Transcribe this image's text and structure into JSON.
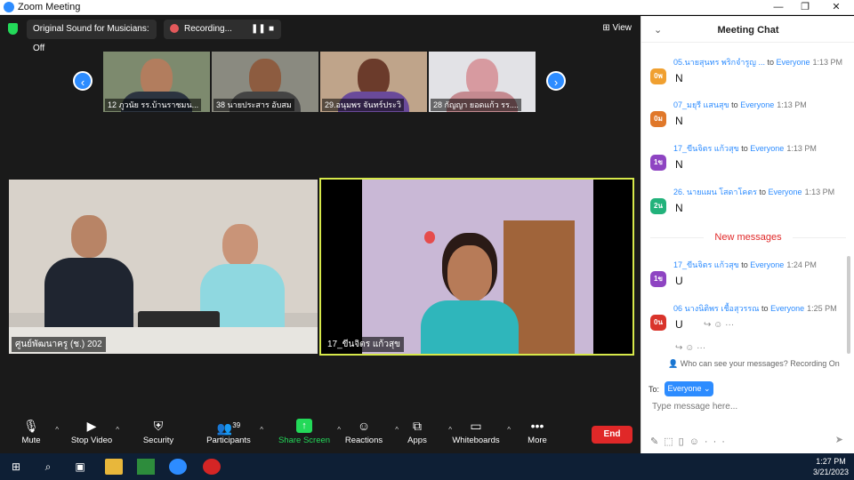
{
  "window": {
    "title": "Zoom Meeting"
  },
  "topbar": {
    "sound_label": "Original Sound for Musicians: Off",
    "recording_label": "Recording...",
    "view_label": "View"
  },
  "thumbnails": [
    {
      "name": "12 ภูวนัย  รร.บ้านราชมน..."
    },
    {
      "name": "38 นายประสาร อับสม"
    },
    {
      "name": "29.อนุมพร จันทร์ประวิ"
    },
    {
      "name": "28 กัญญา  ยอดแก้ว รร...."
    }
  ],
  "main_tiles": [
    {
      "name": "ศูนย์พัฒนาครู (ช.) 202"
    },
    {
      "name": "17_ขีนจิตร แก้วสุข"
    }
  ],
  "toolbar": {
    "mute": "Mute",
    "stop_video": "Stop Video",
    "security": "Security",
    "participants": "Participants",
    "participants_count": "39",
    "share_screen": "Share Screen",
    "reactions": "Reactions",
    "apps": "Apps",
    "whiteboards": "Whiteboards",
    "more": "More",
    "end": "End"
  },
  "chat": {
    "title": "Meeting Chat",
    "messages": [
      {
        "avatar": "0พ",
        "color": "#f0a030",
        "sender": "05.นายสุนทร พริกจำรูญ ...",
        "to": "to",
        "recipient": "Everyone",
        "time": "1:13 PM",
        "text": "N"
      },
      {
        "avatar": "0ม",
        "color": "#e0782a",
        "sender": "07_มยุรี แสนสุข",
        "to": "to",
        "recipient": "Everyone",
        "time": "1:13 PM",
        "text": "N"
      },
      {
        "avatar": "1ข",
        "color": "#8e44c2",
        "sender": "17_ขีนจิตร แก้วสุข",
        "to": "to",
        "recipient": "Everyone",
        "time": "1:13 PM",
        "text": "N"
      },
      {
        "avatar": "2น",
        "color": "#22b27b",
        "sender": "26. นายแผน  โสดาโคตร",
        "to": "to",
        "recipient": "Everyone",
        "time": "1:13 PM",
        "text": "N"
      },
      {
        "avatar": "1ข",
        "color": "#8e44c2",
        "sender": "17_ขีนจิตร แก้วสุข",
        "to": "to",
        "recipient": "Everyone",
        "time": "1:24 PM",
        "text": "U"
      },
      {
        "avatar": "0น",
        "color": "#d9342b",
        "sender": "06 นางนิติพร เชื้อสุวรรณ",
        "to": "to",
        "recipient": "Everyone",
        "time": "1:25 PM",
        "text": "U"
      }
    ],
    "new_messages_label": "New messages",
    "visibility_note": "Who can see your messages? Recording On",
    "to_label": "To:",
    "to_target": "Everyone",
    "input_placeholder": "Type message here..."
  },
  "taskbar": {
    "time": "1:27 PM",
    "date": "3/21/2023"
  }
}
